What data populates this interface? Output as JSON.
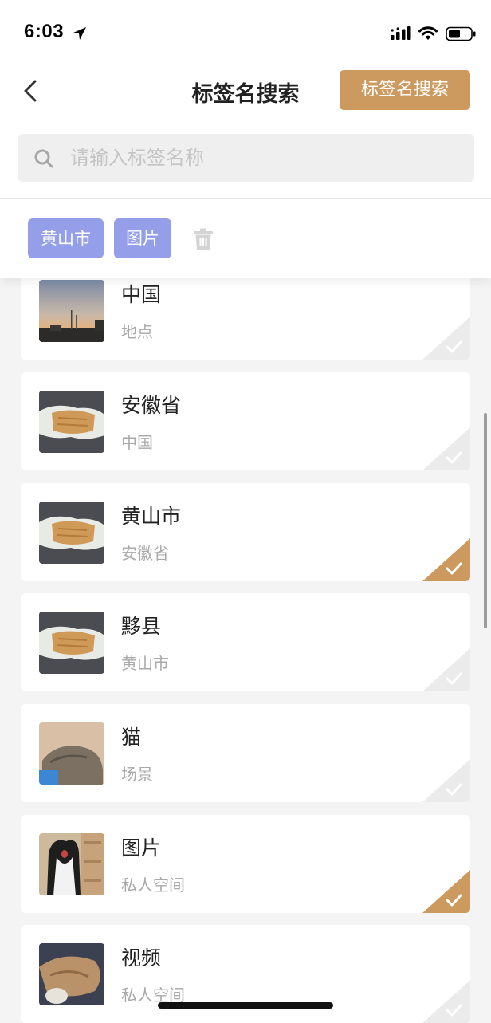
{
  "status_bar": {
    "time": "6:03"
  },
  "nav": {
    "title": "标签名搜索",
    "action_label": "标签名搜索"
  },
  "search": {
    "placeholder": "请输入标签名称",
    "value": ""
  },
  "selected_tags": [
    "黄山市",
    "图片"
  ],
  "items": [
    {
      "title": "中国",
      "subtitle": "地点",
      "checked": false,
      "thumbnail": "sunset-street-photo"
    },
    {
      "title": "安徽省",
      "subtitle": "中国",
      "checked": false,
      "thumbnail": "cat-lying-photo"
    },
    {
      "title": "黄山市",
      "subtitle": "安徽省",
      "checked": true,
      "thumbnail": "cat-lying-photo"
    },
    {
      "title": "黟县",
      "subtitle": "黄山市",
      "checked": false,
      "thumbnail": "cat-lying-photo"
    },
    {
      "title": "猫",
      "subtitle": "场景",
      "checked": false,
      "thumbnail": "cat-sleeping-photo"
    },
    {
      "title": "图片",
      "subtitle": "私人空间",
      "checked": true,
      "thumbnail": "black-white-cat-photo"
    },
    {
      "title": "视频",
      "subtitle": "私人空间",
      "checked": false,
      "thumbnail": "cat-plush-photo"
    }
  ],
  "colors": {
    "accent": "#cc9a5f",
    "chip": "#959ee9",
    "unchecked_corner": "#ebebeb"
  }
}
